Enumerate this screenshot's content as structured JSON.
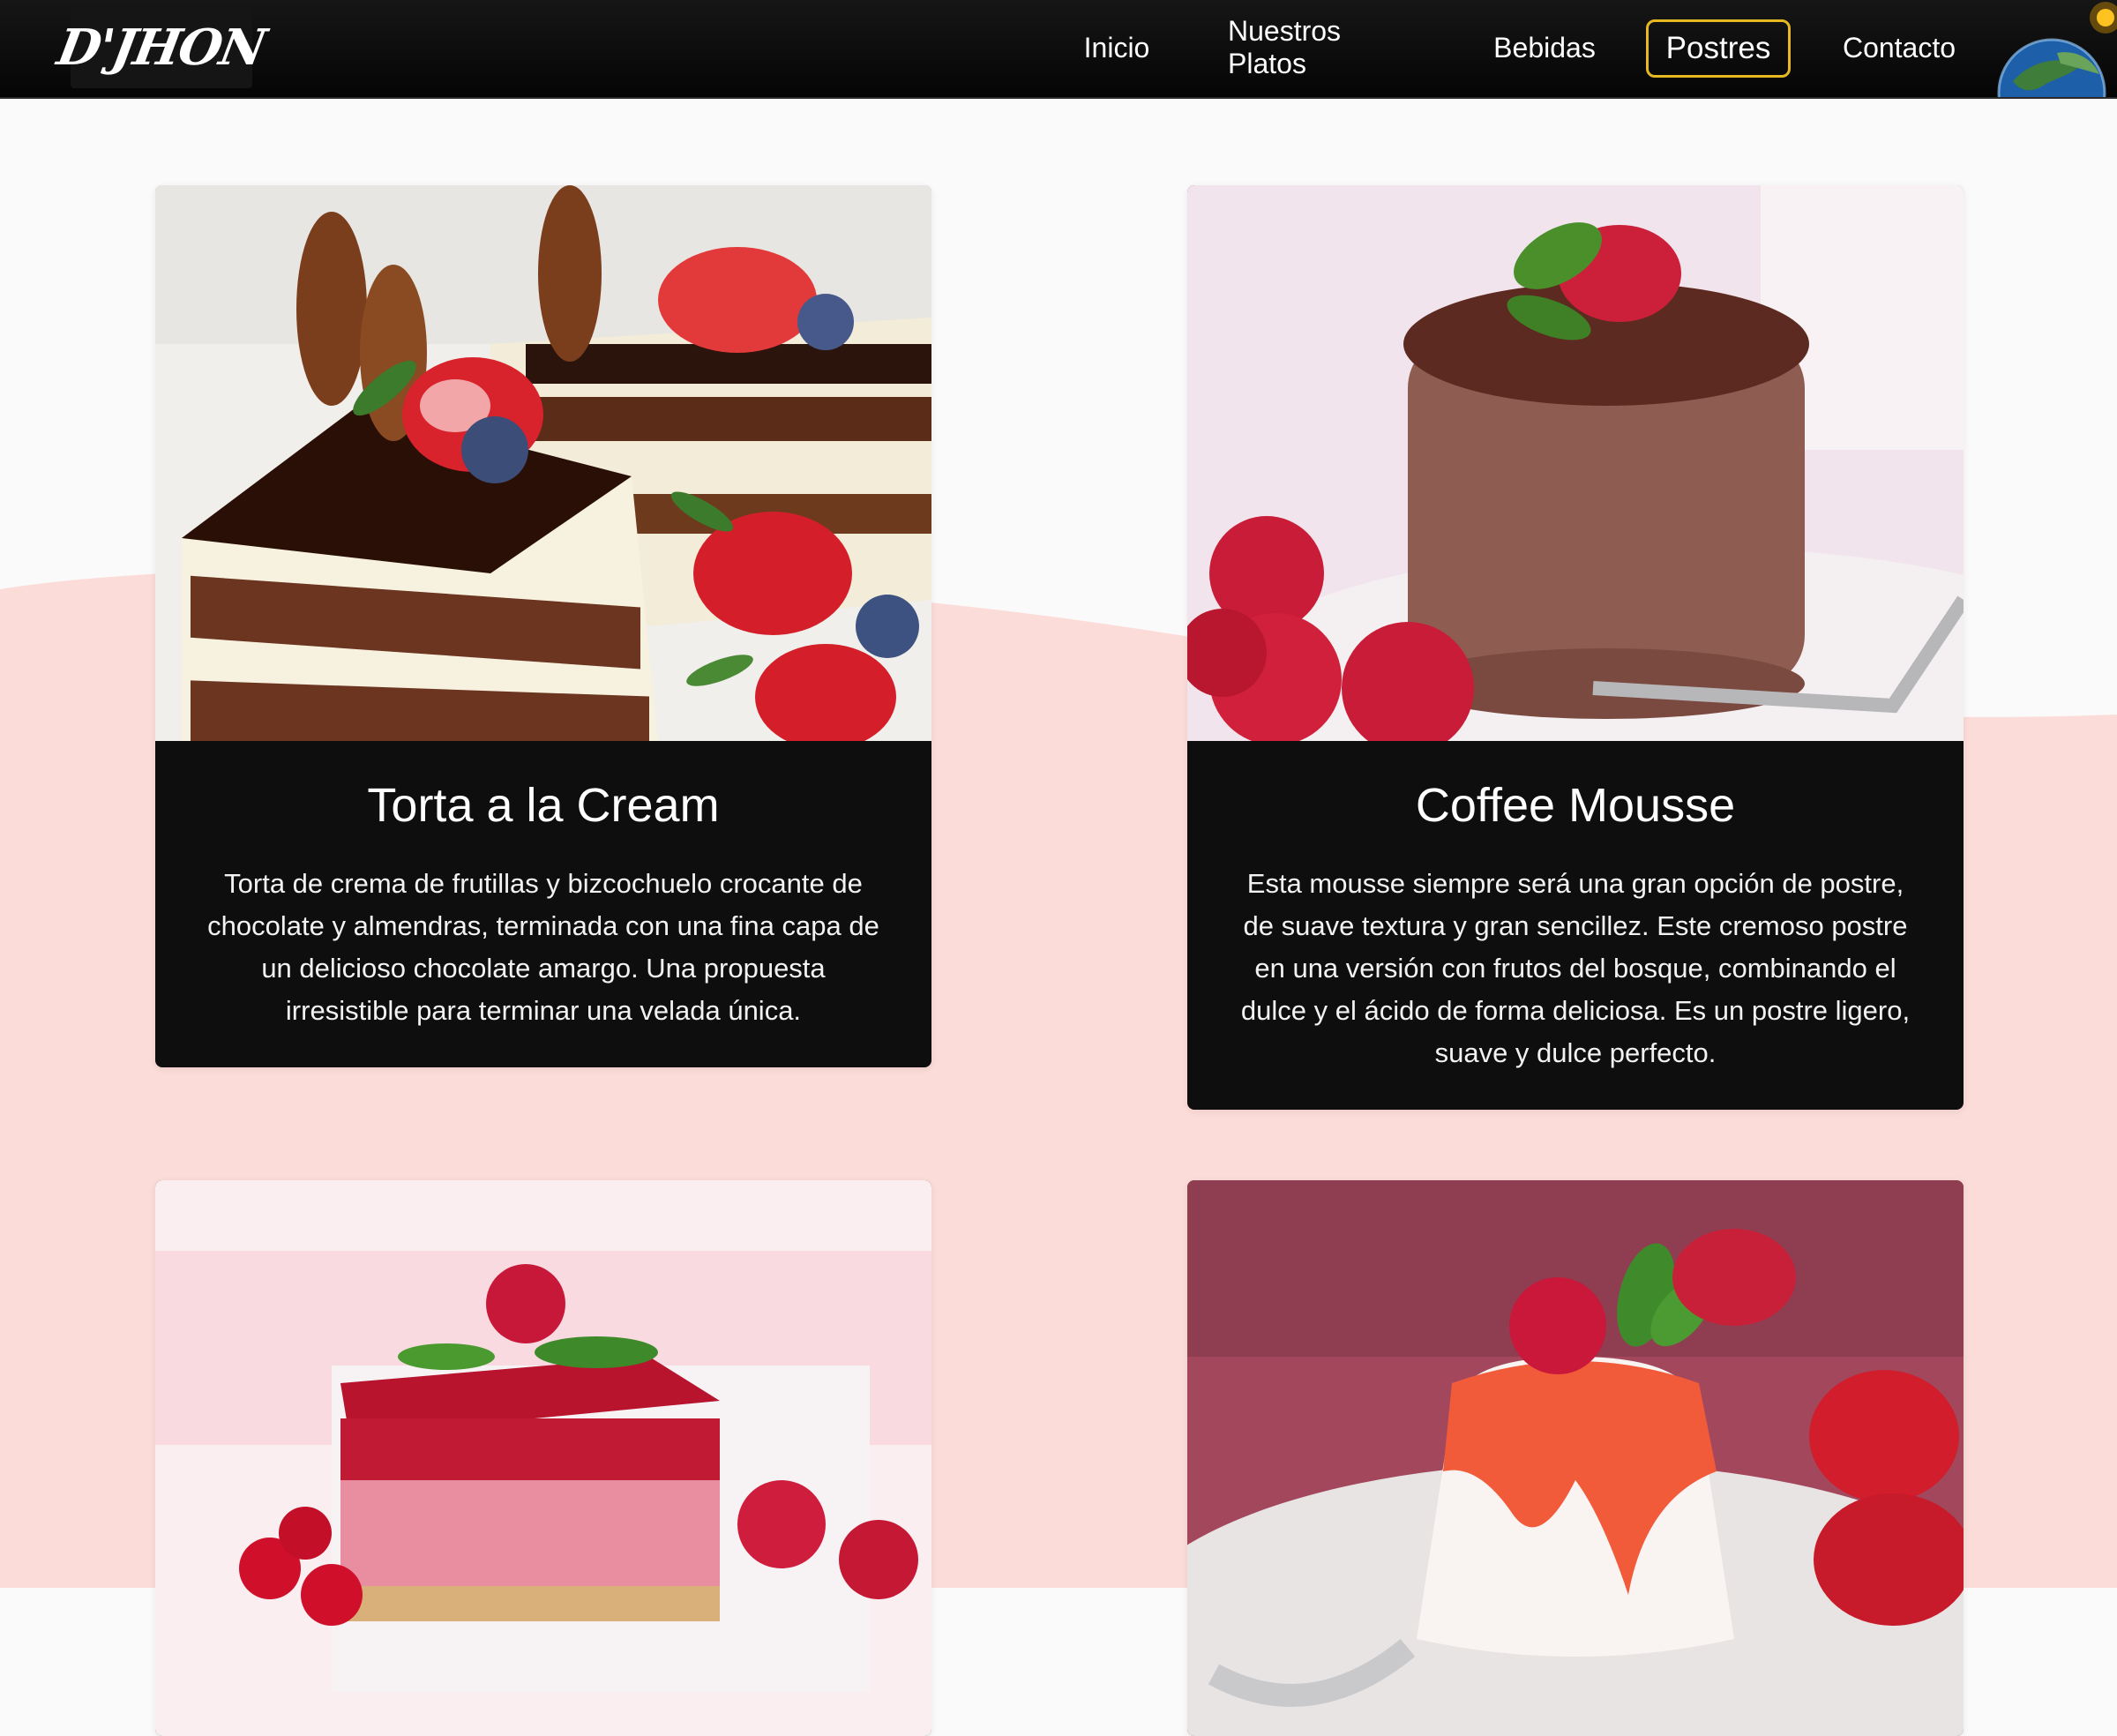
{
  "brand": {
    "logo_text": "D'JHON"
  },
  "nav": {
    "items": [
      {
        "label": "Inicio",
        "active": false
      },
      {
        "label": "Nuestros Platos",
        "active": false
      },
      {
        "label": "Bebidas",
        "active": false
      },
      {
        "label": "Postres",
        "active": true
      },
      {
        "label": "Contacto",
        "active": false
      }
    ],
    "accent_color": "#e6b923"
  },
  "theme": {
    "background": "#fafafa",
    "wave_color": "#fcdcd8",
    "card_background": "#0e0e0e"
  },
  "cards": [
    {
      "title": "Torta a la Cream",
      "description": "Torta de crema de frutillas y bizcochuelo crocante de chocolate y almendras, terminada con una fina capa de un delicioso chocolate amargo. Una propuesta irresistible para terminar una velada única.",
      "image_icon": "layered-cake-photo"
    },
    {
      "title": "Coffee Mousse",
      "description": "Esta mousse siempre será una gran opción de postre, de suave textura y gran sencillez. Este cremoso postre en una versión con frutos del bosque, combinando el dulce y el ácido de forma deliciosa. Es un postre ligero, suave y dulce perfecto.",
      "image_icon": "chocolate-mousse-photo"
    },
    {
      "image_icon": "raspberry-jelly-cake-photo"
    },
    {
      "image_icon": "panna-cotta-photo"
    }
  ]
}
